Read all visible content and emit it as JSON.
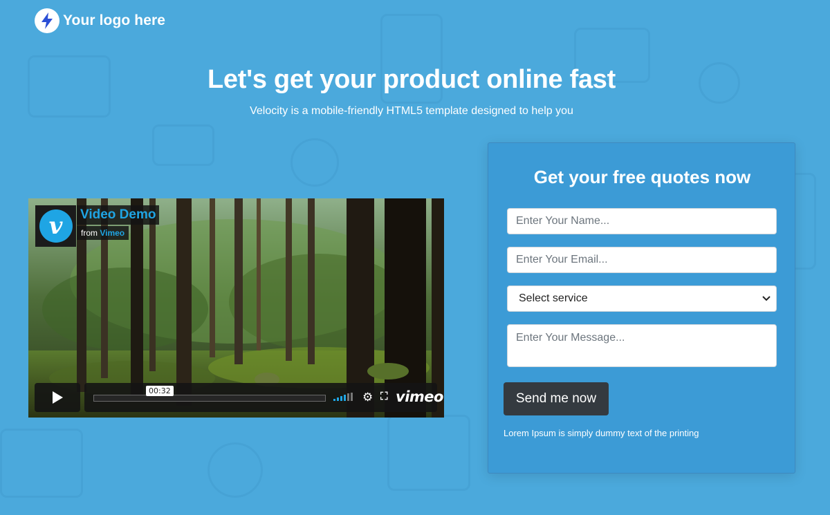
{
  "header": {
    "logo_icon": "lightning-bolt-icon",
    "logo_text": "Your logo here"
  },
  "hero": {
    "title": "Let's get your product online fast",
    "subtitle": "Velocity is a mobile-friendly HTML5 template designed to help you"
  },
  "video": {
    "title": "Video Demo",
    "from_label": "from",
    "from_source": "Vimeo",
    "timecode": "00:32",
    "brand": "vimeo",
    "progress": 0,
    "colors": {
      "accent": "#1fa5e4",
      "controls_bg": "#141414"
    }
  },
  "form": {
    "title": "Get your free quotes now",
    "name_placeholder": "Enter Your Name...",
    "email_placeholder": "Enter Your Email...",
    "service_selected": "Select service",
    "message_placeholder": "Enter Your Message...",
    "submit_label": "Send me now",
    "note": "Lorem Ipsum is simply dummy text of the printing"
  },
  "colors": {
    "page_bg": "#4ba9dc",
    "card_bg": "#3c9bd6",
    "button_bg": "#343a40"
  }
}
